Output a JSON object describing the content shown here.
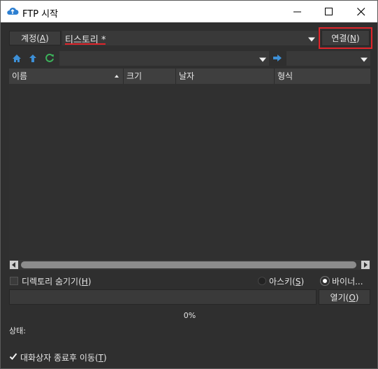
{
  "window": {
    "title": "FTP 시작",
    "min_icon": "minimize-icon",
    "max_icon": "maximize-icon",
    "close_icon": "close-icon"
  },
  "account": {
    "button_label_pre": "계정(",
    "button_mnemonic": "A",
    "button_label_post": ")",
    "selected": "티스토리 *",
    "connect_label_pre": "연결(",
    "connect_mnemonic": "N",
    "connect_label_post": ")"
  },
  "toolbar": {
    "icons": [
      "home-icon",
      "up-arrow-icon",
      "refresh-icon",
      "go-arrow-icon"
    ],
    "path_value": "",
    "local_value": ""
  },
  "file_list": {
    "columns": [
      {
        "label": "이름"
      },
      {
        "label": "크기"
      },
      {
        "label": "날자"
      },
      {
        "label": "형식"
      }
    ],
    "rows": []
  },
  "options": {
    "hide_dirs_pre": "디렉토리 숨기기(",
    "hide_dirs_mnemonic": "H",
    "hide_dirs_post": ")",
    "hide_dirs_checked": false,
    "ascii_pre": "아스키(",
    "ascii_mnemonic": "S",
    "ascii_post": ")",
    "binary_label": "바이너...",
    "mode_selected": "binary"
  },
  "open_file": {
    "value": "",
    "open_pre": "열기(",
    "open_mnemonic": "O",
    "open_post": ")"
  },
  "progress": {
    "text": "0%",
    "value": 0
  },
  "status": {
    "label": "상태:",
    "text": ""
  },
  "close_after": {
    "pre": "대화상자 종료후 이동(",
    "mnemonic": "T",
    "post": ")",
    "checked": true
  },
  "colors": {
    "background": "#2f2f2f",
    "highlight_red": "#e0252b",
    "accent_blue": "#3d8fd6",
    "accent_green": "#3cb25b"
  }
}
